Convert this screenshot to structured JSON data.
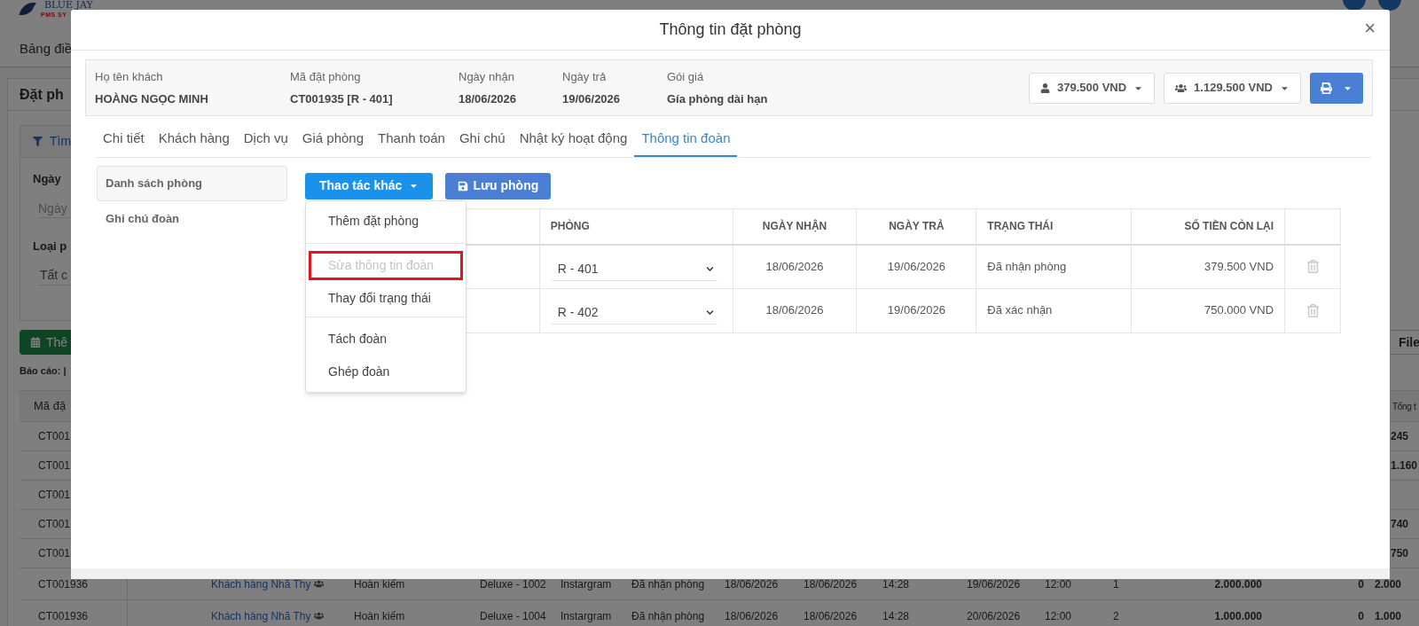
{
  "background_page": {
    "logo": {
      "title": "BLUE JAY",
      "subtitle": "PMS SY"
    },
    "nav": [
      "Bảng điề"
    ],
    "card_title": "Đặt ph",
    "filter": {
      "title": "Tìm",
      "fields": [
        {
          "label": "Ngày",
          "placeholder": "Ngày"
        },
        {
          "label": "Loại p",
          "value": "Tất c"
        }
      ]
    },
    "add_button": "Thê",
    "export_button": "File",
    "report_label": "Báo cáo: |",
    "table": {
      "first_column": "Mã đặ",
      "last_column": "Tổng t",
      "partial_rows": [
        {
          "code": "CT001",
          "total": "245"
        },
        {
          "code": "CT001",
          "total": "1.160"
        },
        {
          "code": "CT001"
        },
        {
          "code": "CT001",
          "total": "740"
        },
        {
          "code": "CT001",
          "total": "750"
        }
      ],
      "rows": [
        {
          "cells": [
            "CT001936",
            "Khách hàng Nhã Thy",
            "Hoàn kiếm",
            "Deluxe - 1002",
            "Instargram",
            "Đã nhận phòng",
            "18/06/2026",
            "18/06/2026",
            "14:28",
            "19/06/2026",
            "12:00",
            "1",
            "2.000.000",
            "0",
            "2.000"
          ]
        },
        {
          "cells": [
            "CT001936",
            "Khách hàng Nhã Thy",
            "Hoàn kiếm",
            "Deluxe - 1004",
            "Instargram",
            "Đã nhận phòng",
            "18/06/2026",
            "18/06/2026",
            "14:28",
            "20/06/2026",
            "12:00",
            "2",
            "1.000.000",
            "0",
            "1.000"
          ]
        }
      ]
    }
  },
  "modal": {
    "title": "Thông tin đặt phòng",
    "close": "×",
    "summary": {
      "fields": [
        {
          "label": "Họ tên khách",
          "value": "HOÀNG NGỌC MINH"
        },
        {
          "label": "Mã đặt phòng",
          "value": "CT001935 [R - 401]"
        },
        {
          "label": "Ngày nhận",
          "value": "18/06/2026"
        },
        {
          "label": "Ngày trả",
          "value": "19/06/2026"
        },
        {
          "label": "Gói giá",
          "value": "Gía phòng dài hạn"
        }
      ],
      "room_total": "379.500 VND",
      "group_total": "1.129.500 VND"
    },
    "tabs": [
      {
        "label": "Chi tiết",
        "selected": false
      },
      {
        "label": "Khách hàng",
        "selected": false
      },
      {
        "label": "Dịch vụ",
        "selected": false
      },
      {
        "label": "Giá phòng",
        "selected": false
      },
      {
        "label": "Thanh toán",
        "selected": false
      },
      {
        "label": "Ghi chú",
        "selected": false
      },
      {
        "label": "Nhật ký hoạt động",
        "selected": false
      },
      {
        "label": "Thông tin đoàn",
        "selected": true
      }
    ],
    "side_menu": [
      {
        "label": "Danh sách phòng",
        "selected": true
      },
      {
        "label": "Ghi chú đoàn",
        "selected": false
      }
    ],
    "actions_button": "Thao tác khác",
    "save_button": "Lưu phòng",
    "actions_menu": [
      [
        {
          "label": "Thêm đặt phòng",
          "disabled": false,
          "highlighted": false
        }
      ],
      [
        {
          "label": "Sửa thông tin đoàn",
          "disabled": true,
          "highlighted": true
        },
        {
          "label": "Thay đổi trạng thái",
          "disabled": false,
          "highlighted": false
        }
      ],
      [
        {
          "label": "Tách đoàn",
          "disabled": false,
          "highlighted": false
        },
        {
          "label": "Ghép đoàn",
          "disabled": false,
          "highlighted": false
        }
      ]
    ],
    "rooms_table": {
      "columns": [
        "PHÒNG",
        "NGÀY NHẬN",
        "NGÀY TRẢ",
        "TRẠNG THÁI",
        "SỐ TIỀN CÒN LẠI"
      ],
      "rows": [
        {
          "room": "R - 401",
          "check_in": "18/06/2026",
          "check_out": "19/06/2026",
          "status": "Đã nhận phòng",
          "balance": "379.500 VND"
        },
        {
          "room": "R - 402",
          "check_in": "18/06/2026",
          "check_out": "19/06/2026",
          "status": "Đã xác nhận",
          "balance": "750.000 VND"
        }
      ]
    }
  }
}
